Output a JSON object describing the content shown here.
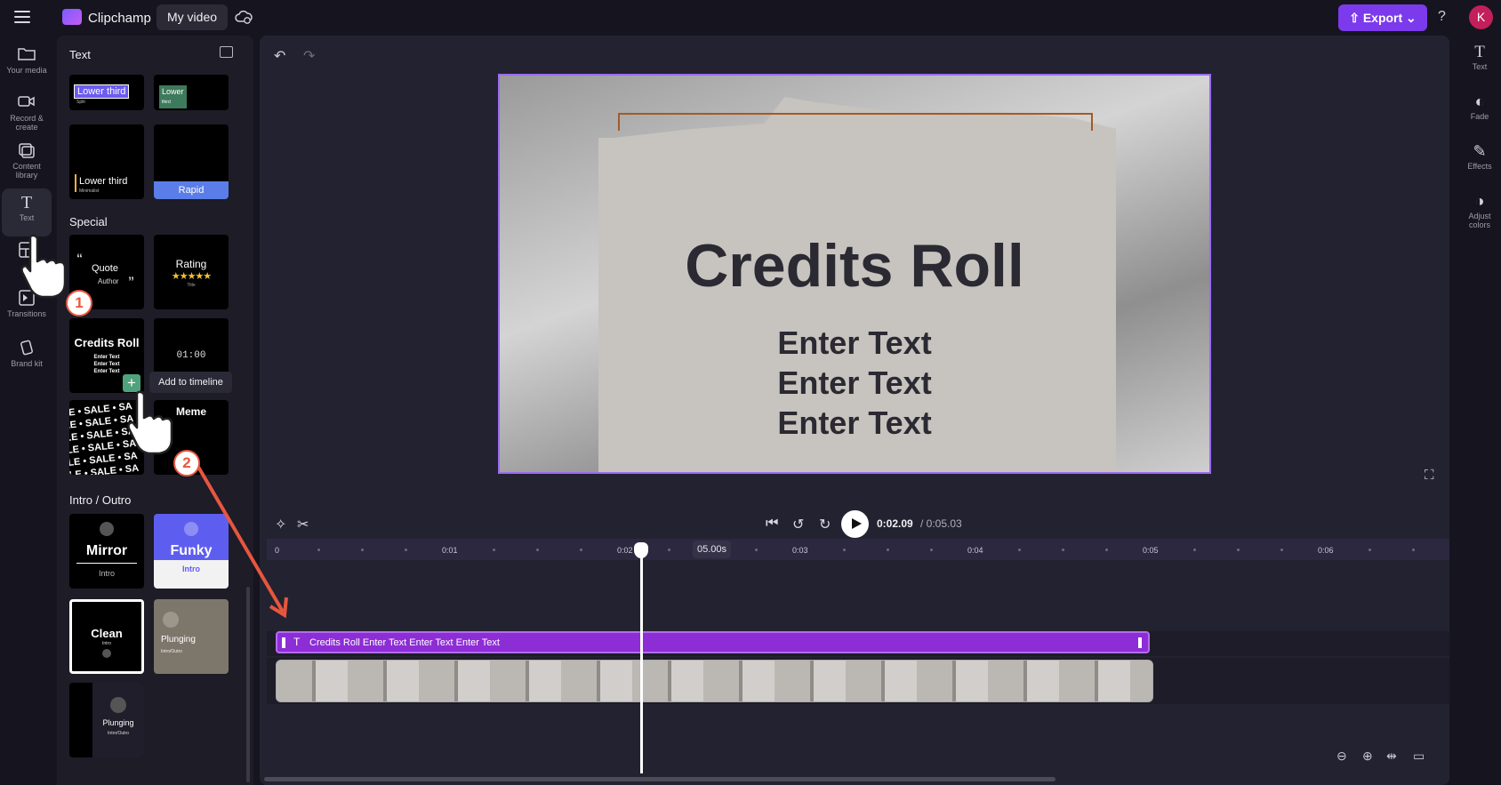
{
  "topbar": {
    "app_name": "Clipchamp",
    "video_title": "My video",
    "export_label": "Export",
    "help": "?",
    "avatar_initial": "K"
  },
  "left_nav": [
    {
      "label": "Your media",
      "icon": "folder-icon"
    },
    {
      "label": "Record & create",
      "icon": "camera-icon"
    },
    {
      "label": "Content library",
      "icon": "library-icon"
    },
    {
      "label": "Text",
      "icon": "text-icon"
    },
    {
      "label": "Templates",
      "icon": "templates-icon"
    },
    {
      "label": "Transitions",
      "icon": "transitions-icon"
    },
    {
      "label": "Brand kit",
      "icon": "brand-kit-icon"
    }
  ],
  "panel": {
    "title": "Text",
    "sections": {
      "special": "Special",
      "intro_outro": "Intro / Outro"
    },
    "cards": {
      "lower_third_split": {
        "title": "Lower third",
        "sub": "Split"
      },
      "lower_third_green": {
        "title": "Lower",
        "sub": "third"
      },
      "lower_third_min": {
        "title": "Lower third",
        "sub": "Minimalist"
      },
      "rapid": {
        "title": "Rapid"
      },
      "quote": {
        "title": "Quote",
        "sub": "Author"
      },
      "rating": {
        "title": "Rating",
        "sub": "Title",
        "stars": "★★★★★"
      },
      "credits": {
        "title": "Credits Roll",
        "line": "Enter Text"
      },
      "timer": {
        "title": "01:00"
      },
      "sale": {
        "line": "LE • SALE • SA"
      },
      "meme": {
        "title": "Meme"
      },
      "mirror": {
        "title": "Mirror",
        "sub": "Intro"
      },
      "funky": {
        "title": "Funky",
        "sub": "Intro"
      },
      "clean": {
        "title": "Clean",
        "sub": "Intro"
      },
      "plunging": {
        "title": "Plunging",
        "sub": "Intro/Outro"
      },
      "plunging2": {
        "title": "Plunging",
        "sub": "Intro/Outro"
      }
    },
    "tooltip": "Add to timeline"
  },
  "preview": {
    "title": "Credits Roll",
    "lines": [
      "Enter Text",
      "Enter Text",
      "Enter Text"
    ]
  },
  "playback": {
    "current": "0:02.09",
    "total": "/ 0:05.03"
  },
  "ruler": {
    "ticks": [
      "0",
      "0:01",
      "0:02",
      "0:03",
      "0:04",
      "0:05",
      "0:06"
    ],
    "chip": "05.00s"
  },
  "timeline": {
    "text_clip_label": "Credits Roll Enter Text Enter Text Enter Text",
    "text_clip_icon": "T"
  },
  "right_nav": [
    {
      "label": "Text",
      "icon": "text-icon"
    },
    {
      "label": "Fade",
      "icon": "fade-icon"
    },
    {
      "label": "Effects",
      "icon": "effects-icon"
    },
    {
      "label": "Adjust colors",
      "icon": "adjust-colors-icon"
    }
  ],
  "annotations": {
    "step1": "1",
    "step2": "2"
  },
  "colors": {
    "accent": "#7c3aed",
    "text_clip": "#8d2dd6",
    "annotation": "#e8563f"
  }
}
